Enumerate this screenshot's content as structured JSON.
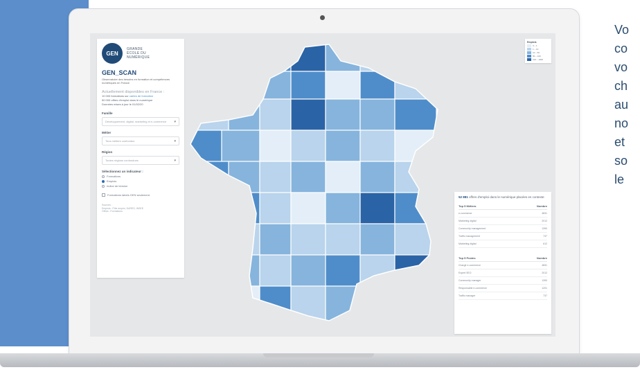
{
  "app": {
    "logo_abbr": "GEN",
    "logo_lines": [
      "GRANDE",
      "ÉCOLE DU",
      "NUMÉRIQUE"
    ],
    "title": "GEN_SCAN",
    "description": "Observatoire des besoins en formation et compétences numériques en France"
  },
  "sidebar": {
    "available_heading": "Actuellement disponibles en France :",
    "stats": [
      {
        "text": "10 000 formations sur ",
        "link": "cartes de formation"
      },
      {
        "text": "50 000 offres d'emploi dans le numérique",
        "link": ""
      },
      {
        "text": "Données mises à jour le 01/02/20",
        "link": ""
      }
    ],
    "filters": [
      {
        "label": "Famille",
        "value": "Développement, digital, marketing et e-commerce"
      },
      {
        "label": "Métier",
        "value": "Tous métiers confondus"
      },
      {
        "label": "Région",
        "value": "Toutes régions confondues"
      }
    ],
    "indicator_label": "Sélectionnez un indicateur :",
    "indicators": [
      {
        "label": "Formations",
        "selected": false
      },
      {
        "label": "Emplois",
        "selected": true
      },
      {
        "label": "Indice de tension",
        "selected": false
      }
    ],
    "checkbox_label": "Formations labels GEN seulement",
    "sources": [
      "Sources :",
      "Emplois : Pôle emploi, DARES, INSEE",
      "Offres : Formations"
    ]
  },
  "legend": {
    "title": "Emplois",
    "items": [
      {
        "label": "0 – 1",
        "color": "#e3eef8"
      },
      {
        "label": "1 – 10",
        "color": "#b9d4ec"
      },
      {
        "label": "10 – 50",
        "color": "#86b4dd"
      },
      {
        "label": "50 – 100",
        "color": "#4f8dca"
      },
      {
        "label": "100 – 1000",
        "color": "#2a63a6"
      }
    ]
  },
  "panel": {
    "highlight": "52 881",
    "headline": " offres d'emploi dans le numérique placées en contexte",
    "table1": {
      "header": [
        "Top 5 Métiers",
        "Nombre"
      ],
      "rows": [
        [
          "e-commerce",
          "4831"
        ],
        [
          "Marketing digital",
          "2012"
        ],
        [
          "Community management",
          "1390"
        ],
        [
          "Traffic management",
          "737"
        ],
        [
          "Marketing digital",
          "612"
        ]
      ]
    },
    "table2": {
      "header": [
        "Top 5 Postes",
        "Nombre"
      ],
      "rows": [
        [
          "Chargé e-commerce",
          "4831"
        ],
        [
          "Expert SEO",
          "2012"
        ],
        [
          "Community manager",
          "1390"
        ],
        [
          "Responsable e-commerce",
          "1201"
        ],
        [
          "Traffic manager",
          "737"
        ]
      ]
    }
  },
  "side_text_lines": [
    "Vo",
    "co",
    "vo",
    "ch",
    "au",
    "no",
    "et",
    "so",
    "le"
  ],
  "colors": {
    "band": "#5b8ecb",
    "accent": "#214b77"
  }
}
